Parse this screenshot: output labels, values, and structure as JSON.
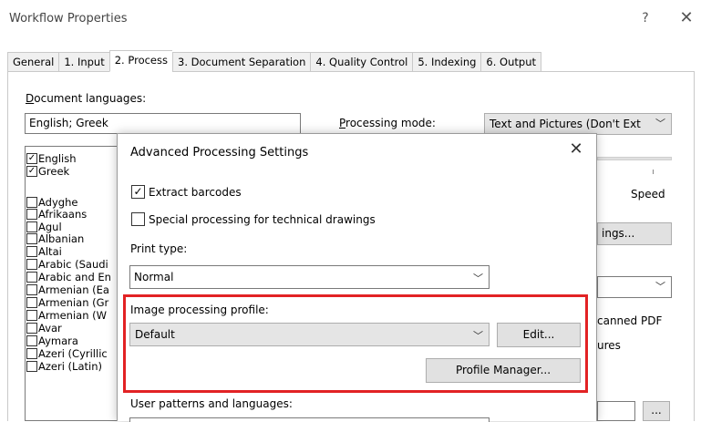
{
  "window": {
    "title": "Workflow Properties",
    "help_glyph": "?",
    "close_glyph": "✕"
  },
  "tabs": [
    {
      "label": "General"
    },
    {
      "label": "1. Input"
    },
    {
      "label": "2. Process"
    },
    {
      "label": "3. Document Separation"
    },
    {
      "label": "4. Quality Control"
    },
    {
      "label": "5. Indexing"
    },
    {
      "label": "6. Output"
    }
  ],
  "process": {
    "doc_lang_label_first": "D",
    "doc_lang_label_rest": "ocument languages:",
    "doc_lang_value": "English; Greek",
    "mode_label_first": "P",
    "mode_label_rest": "rocessing mode:",
    "mode_value": "Text and Pictures (Don't Ext",
    "speed_label": "Speed",
    "settings_button_partial": "ings...",
    "scanned_pdf_partial": "canned PDF",
    "pictures_partial": "ures",
    "more_button": "..."
  },
  "languages": [
    {
      "label": "English",
      "checked": true
    },
    {
      "label": "Greek",
      "checked": true
    },
    {
      "label": "Adyghe",
      "checked": false
    },
    {
      "label": "Afrikaans",
      "checked": false
    },
    {
      "label": "Agul",
      "checked": false
    },
    {
      "label": "Albanian",
      "checked": false
    },
    {
      "label": "Altai",
      "checked": false
    },
    {
      "label": "Arabic (Saudi",
      "checked": false
    },
    {
      "label": "Arabic and En",
      "checked": false
    },
    {
      "label": "Armenian (Ea",
      "checked": false
    },
    {
      "label": "Armenian (Gr",
      "checked": false
    },
    {
      "label": "Armenian (W",
      "checked": false
    },
    {
      "label": "Avar",
      "checked": false
    },
    {
      "label": "Aymara",
      "checked": false
    },
    {
      "label": "Azeri (Cyrillic",
      "checked": false
    },
    {
      "label": "Azeri (Latin)",
      "checked": false
    }
  ],
  "dialog": {
    "title": "Advanced Processing Settings",
    "close_glyph": "✕",
    "check_mark": "✓",
    "extract_barcodes": {
      "label": "Extract barcodes",
      "checked": true
    },
    "technical_drawings": {
      "label": "Special processing for technical drawings",
      "checked": false
    },
    "print_type_label": "Print type:",
    "print_type_value": "Normal",
    "image_profile_label": "Image processing profile:",
    "image_profile_value": "Default",
    "edit_button": "Edit...",
    "profile_manager_button": "Profile Manager...",
    "user_patterns_label": "User patterns and languages:"
  },
  "icons": {
    "chevron": "﹀"
  },
  "colors": {
    "highlight": "#e22224"
  }
}
